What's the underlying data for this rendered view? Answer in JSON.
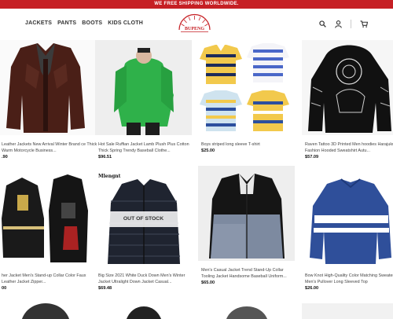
{
  "banner": {
    "text": "WE FREE SHIPPING WORLDWIDE."
  },
  "nav": {
    "items": [
      "JACKETS",
      "PANTS",
      "BOOTS",
      "KIDS CLOTH"
    ]
  },
  "logo": {
    "text": "BUPENG"
  },
  "icons": {
    "search": "search-icon",
    "account": "user-icon",
    "cart": "cart-icon"
  },
  "products": [
    {
      "title": "Leather Jackets New Arrival Winter Brand ce Thick Warm Motorcycle Business...",
      "price": ".90"
    },
    {
      "title": "Hot Sale Ruffian Jacket Lamb Plush Plus Cotton Thick Spring Trendy Baseball Clothe...",
      "price": "$96.51"
    },
    {
      "title": "Boys striped long sleeve T-shirt",
      "price": "$25.00"
    },
    {
      "title": "Raven Tattoo 3D Printed Men hoodies Harajuku Fashion Hooded Sweatshirt Autu...",
      "price": "$57.09"
    },
    {
      "title": "her Jacket Men's Stand-up Collar Color Faux Leather Jacket Zipper...",
      "price": "00"
    },
    {
      "title": "Big Size 2021 White Duck Down Men's Winter Jacket Ultralight Down Jacket Casual...",
      "price": "$69.48",
      "badge": "OUT OF STOCK",
      "brand": "Mlengnt"
    },
    {
      "title": "Men's Casual Jacket Trend Stand-Up Collar Tooling Jacket Handsome Baseball Uniform...",
      "price": "$65.00"
    },
    {
      "title": "Bow Knot High-Quality Color Matching Sweater Men's Pullover Long Sleeved Top",
      "price": "$26.00"
    }
  ],
  "colors": {
    "banner": "#c61f24",
    "accent": "#c61f24"
  }
}
